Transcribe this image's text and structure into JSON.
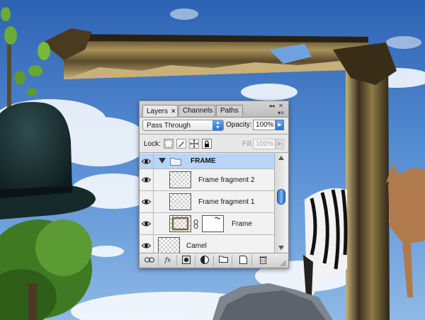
{
  "layers_panel": {
    "tabs": [
      {
        "label": "Layers",
        "close": "✕",
        "active": true
      },
      {
        "label": "Channels",
        "active": false
      },
      {
        "label": "Paths",
        "active": false
      }
    ],
    "blend_mode": "Pass Through",
    "opacity_label": "Opacity:",
    "opacity_value": "100%",
    "lock_label": "Lock:",
    "fill_label": "Fill:",
    "fill_value": "100%",
    "group_name": "FRAME",
    "layers": [
      {
        "name": "Frame fragment 2"
      },
      {
        "name": "Frame fragment 1"
      },
      {
        "name": "Frame",
        "has_mask": true
      },
      {
        "name": "Camel"
      }
    ]
  },
  "colors": {
    "selection": "#b7d5f7",
    "accent_blue": "#2c6fd6",
    "sky": "#3e78c4"
  }
}
